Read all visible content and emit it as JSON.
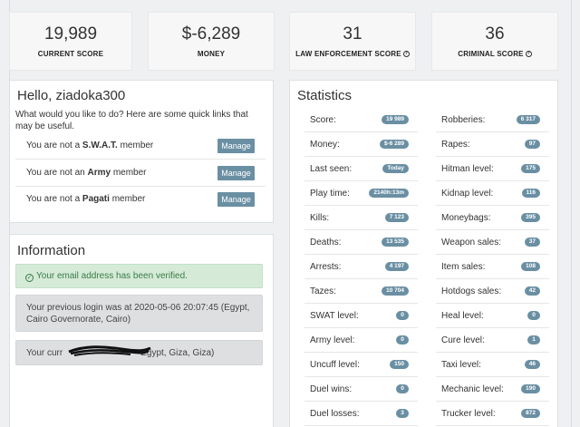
{
  "top_stats": [
    {
      "value": "19,989",
      "label": "CURRENT SCORE",
      "help": false
    },
    {
      "value": "$-6,289",
      "label": "MONEY",
      "help": false
    },
    {
      "value": "31",
      "label": "LAW ENFORCEMENT SCORE",
      "help": true
    },
    {
      "value": "36",
      "label": "CRIMINAL SCORE",
      "help": true
    }
  ],
  "hello": {
    "title": "Hello, ziadoka300",
    "intro": "What would you like to do? Here are some quick links that may be useful.",
    "memberships": [
      {
        "prefix": "You are not a ",
        "group": "S.W.A.T.",
        "suffix": " member",
        "button": "Manage"
      },
      {
        "prefix": "You are not an ",
        "group": "Army",
        "suffix": " member",
        "button": "Manage"
      },
      {
        "prefix": "You are not a ",
        "group": "Pagati",
        "suffix": " member",
        "button": "Manage"
      }
    ]
  },
  "information": {
    "title": "Information",
    "verified": "Your email address has been verified.",
    "previous_login": "Your previous login was at 2020-05-06 20:07:45 (Egypt, Cairo Governorate, Cairo)",
    "current_prefix": "Your curr",
    "current_suffix": "Egypt, Giza, Giza)"
  },
  "statistics": {
    "title": "Statistics",
    "left": [
      {
        "name": "Score:",
        "value": "19 989"
      },
      {
        "name": "Money:",
        "value": "$-6 289"
      },
      {
        "name": "Last seen:",
        "value": "Today"
      },
      {
        "name": "Play time:",
        "value": "2140h:13m"
      },
      {
        "name": "Kills:",
        "value": "7 123"
      },
      {
        "name": "Deaths:",
        "value": "13 535"
      },
      {
        "name": "Arrests:",
        "value": "4 197"
      },
      {
        "name": "Tazes:",
        "value": "10 704"
      },
      {
        "name": "SWAT level:",
        "value": "0"
      },
      {
        "name": "Army level:",
        "value": "0"
      },
      {
        "name": "Uncuff level:",
        "value": "150"
      },
      {
        "name": "Duel wins:",
        "value": "0"
      },
      {
        "name": "Duel losses:",
        "value": "3"
      }
    ],
    "right": [
      {
        "name": "Robberies:",
        "value": "6 317"
      },
      {
        "name": "Rapes:",
        "value": "97"
      },
      {
        "name": "Hitman level:",
        "value": "175"
      },
      {
        "name": "Kidnap level:",
        "value": "116"
      },
      {
        "name": "Moneybags:",
        "value": "395"
      },
      {
        "name": "Weapon sales:",
        "value": "37"
      },
      {
        "name": "Item sales:",
        "value": "108"
      },
      {
        "name": "Hotdogs sales:",
        "value": "42"
      },
      {
        "name": "Heal level:",
        "value": "0"
      },
      {
        "name": "Cure level:",
        "value": "1"
      },
      {
        "name": "Taxi level:",
        "value": "46"
      },
      {
        "name": "Mechanic level:",
        "value": "190"
      },
      {
        "name": "Trucker level:",
        "value": "872"
      }
    ]
  },
  "colors": {
    "badge": "#6a8fa3",
    "success_bg": "#d5ebd8",
    "alert_bg": "#dddfe1"
  }
}
